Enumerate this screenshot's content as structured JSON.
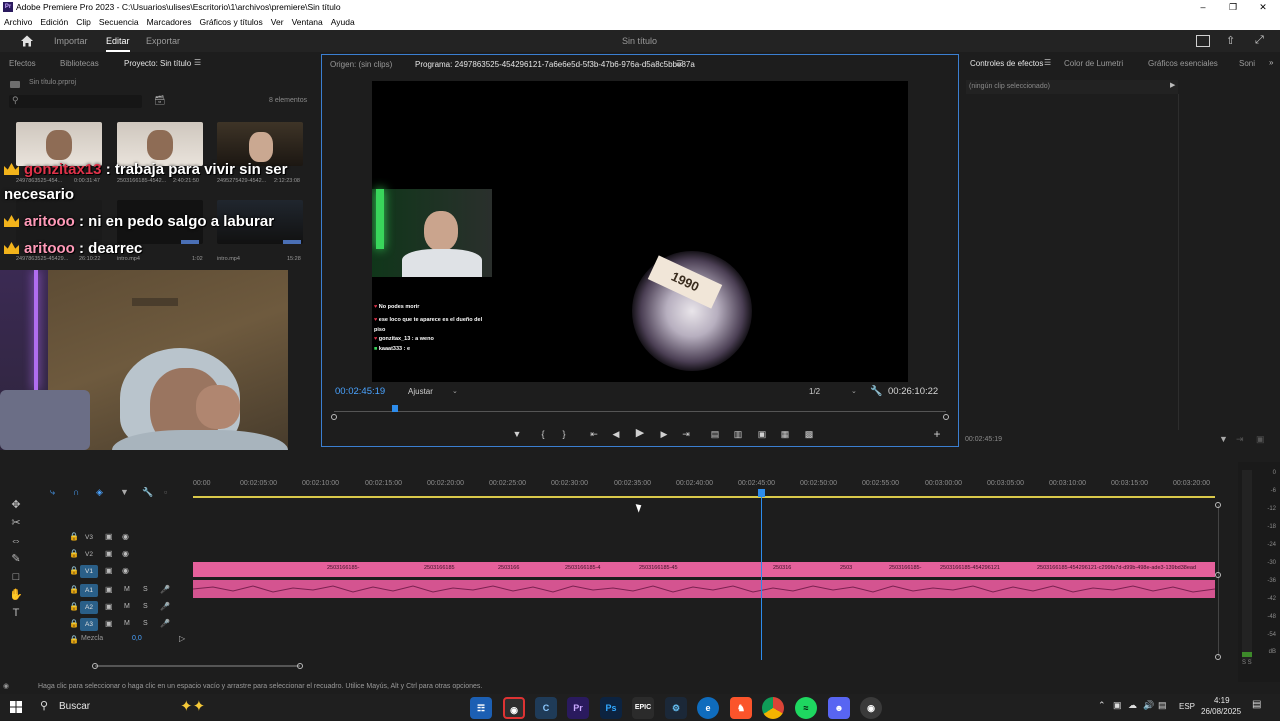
{
  "window": {
    "title": "Adobe Premiere Pro 2023 - C:\\Usuarios\\ulises\\Escritorio\\1\\archivos\\premiere\\Sin título",
    "controls": [
      "minimize-icon",
      "restore-icon",
      "close-icon"
    ]
  },
  "menu": [
    "Archivo",
    "Edición",
    "Clip",
    "Secuencia",
    "Marcadores",
    "Gráficos y títulos",
    "Ver",
    "Ventana",
    "Ayuda"
  ],
  "appbar": {
    "tabs": [
      {
        "label": "Importar",
        "active": false
      },
      {
        "label": "Editar",
        "active": true
      },
      {
        "label": "Exportar",
        "active": false
      }
    ],
    "project_title": "Sin título"
  },
  "project_panel": {
    "tabs": [
      "Efectos",
      "Bibliotecas",
      "Proyecto: Sin título"
    ],
    "file": "Sin título.prproj",
    "item_count": "8 elementos",
    "items": [
      {
        "name": "2497863525-454...",
        "duration": "0:00:31:47"
      },
      {
        "name": "2503166185-4542...",
        "duration": "2:40:21:50"
      },
      {
        "name": "2495275429-4542...",
        "duration": "2:12:23:08"
      },
      {
        "name": "2497863525-45429...",
        "duration": "26:10:22"
      },
      {
        "name": "intro.mp4",
        "duration": "1:02"
      },
      {
        "name": "intro.mp4",
        "duration": "15:28"
      }
    ]
  },
  "overlay_chat": [
    {
      "user": "gonzitax13",
      "text": ": trabaja para vivir sin ser",
      "user_color": "#e0334a"
    },
    {
      "user": "",
      "text": "necesario",
      "user_color": ""
    },
    {
      "user": "aritooo",
      "text": ": ni en pedo salgo a laburar",
      "user_color": "#ff9ab8"
    },
    {
      "user": "aritooo",
      "text": ": dearrec",
      "user_color": "#ff9ab8"
    }
  ],
  "monitor": {
    "source_tab": "Origen: (sin clips)",
    "program_tab": "Programa: 2497863525-454296121-7a6e6e5d-5f3b-47b6-976a-d5a8c5bbe87a",
    "timecode_current": "00:02:45:19",
    "fit": "Ajustar",
    "resolution": "1/2",
    "timecode_duration": "00:26:10:22",
    "frame_text": "1990",
    "mini_chat": [
      "No podes morir",
      "ese loco que te aparece es el dueño del piso",
      "gonzitax_13 : a weno",
      "kaaat333 : e"
    ]
  },
  "effects_panel": {
    "tabs": [
      "Controles de efectos",
      "Color de Lumetri",
      "Gráficos esenciales",
      "Soni"
    ],
    "empty_text": "(ningún clip seleccionado)",
    "footer_timecode": "00:02:45:19"
  },
  "timeline": {
    "ruler": [
      "00:00",
      "00:02:05:00",
      "00:02:10:00",
      "00:02:15:00",
      "00:02:20:00",
      "00:02:25:00",
      "00:02:30:00",
      "00:02:35:00",
      "00:02:40:00",
      "00:02:45:00",
      "00:02:50:00",
      "00:02:55:00",
      "00:03:00:00",
      "00:03:05:00",
      "00:03:10:00",
      "00:03:15:00",
      "00:03:20:00"
    ],
    "video_tracks": [
      "V3",
      "V2",
      "V1"
    ],
    "audio_tracks": [
      "A1",
      "A2",
      "A3"
    ],
    "mix_label": "Mezcla",
    "mix_value": "0,0",
    "mute_label": "M",
    "solo_label": "S",
    "clip_names": [
      "2503166185-",
      "2503166185",
      "2503166",
      "2503166185-4",
      "2503166185-45",
      "250316",
      "2503",
      "2503166185-",
      "2503166185-454296121",
      "2503166185-454296121-c299fa7d-d99b-498e-ade3-139bd38ead"
    ]
  },
  "vu_meter": {
    "ticks": [
      "0",
      "-6",
      "-12",
      "-18",
      "-24",
      "-30",
      "-36",
      "-42",
      "-48",
      "-54",
      "dB"
    ],
    "solo": "S S"
  },
  "status_bar": "Haga clic para seleccionar o haga clic en un espacio vacío y arrastre para seleccionar el recuadro. Utilice Mayús, Alt y Ctrl para otras opciones.",
  "taskbar": {
    "search": "Buscar",
    "language": "ESP",
    "time": "4:19",
    "date": "26/08/2025"
  },
  "colors": {
    "accent": "#2d8ceb",
    "clip_video": "#e5609b",
    "clip_audio": "#d45490",
    "panel_bg": "#1d1d1d"
  }
}
